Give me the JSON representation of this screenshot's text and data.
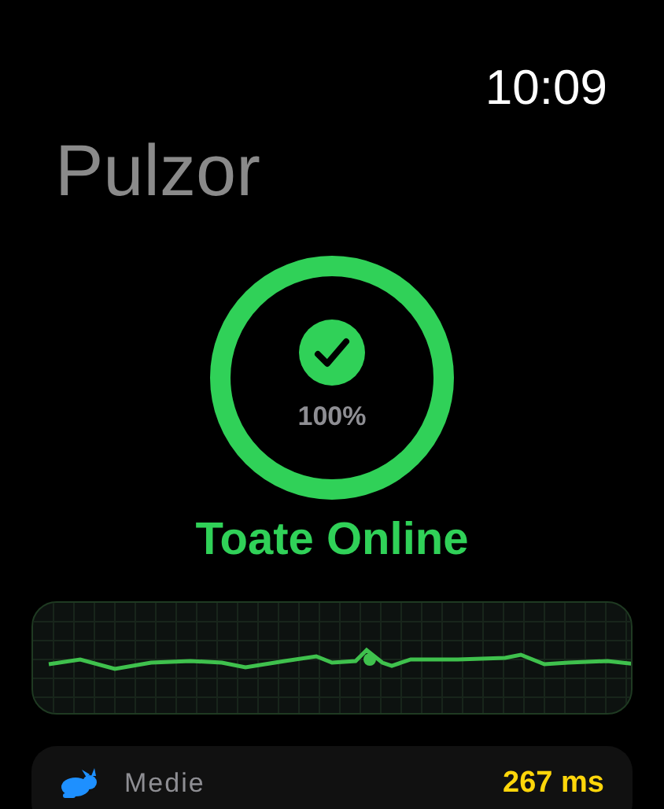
{
  "status_bar": {
    "time": "10:09"
  },
  "app": {
    "title": "Pulzor"
  },
  "uptime": {
    "level": 1,
    "percent": "100%",
    "status": "Toate Online"
  },
  "stats": [
    {
      "label": "Medie",
      "value": "267 ms"
    }
  ]
}
